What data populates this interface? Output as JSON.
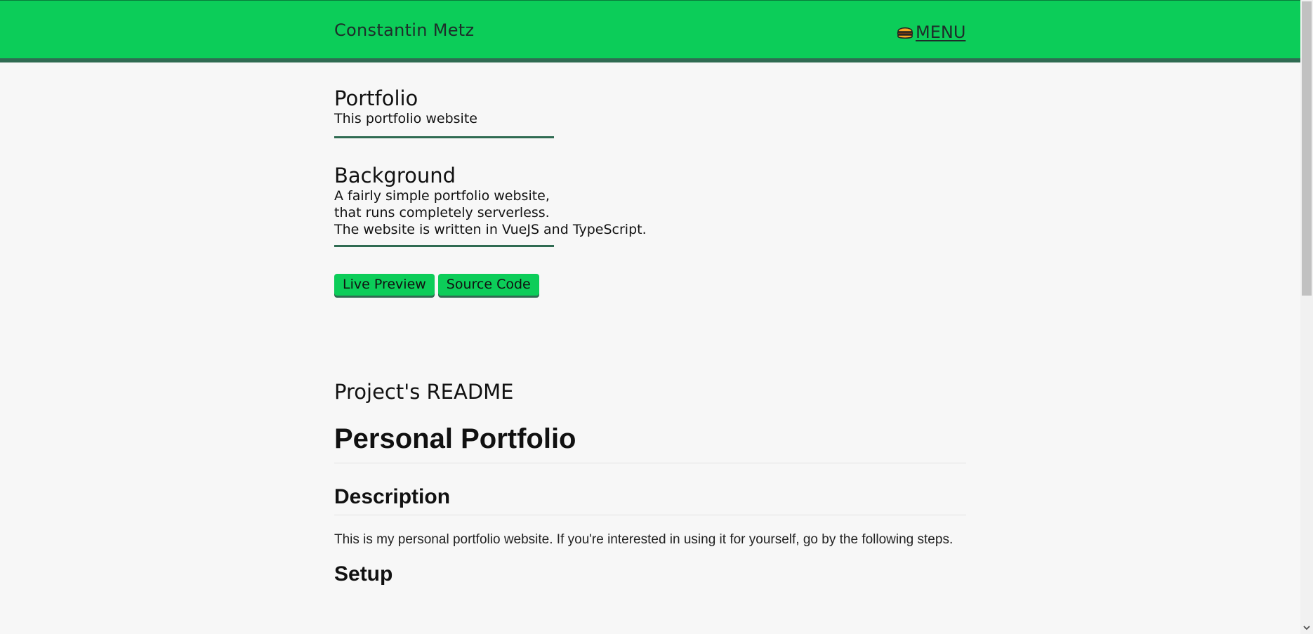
{
  "header": {
    "site_title": "Constantin Metz",
    "menu_label": "MENU",
    "menu_icon": "burger-icon"
  },
  "project": {
    "title": "Portfolio",
    "subtitle": "This portfolio website",
    "background_heading": "Background",
    "background_lines": [
      "A fairly simple portfolio website,",
      "that runs completely serverless.",
      "The website is written in VueJS and TypeScript."
    ],
    "buttons": {
      "live_preview": "Live Preview",
      "source_code": "Source Code"
    }
  },
  "readme": {
    "section_title": "Project's README",
    "h1": "Personal Portfolio",
    "description_heading": "Description",
    "description_text": "This is my personal portfolio website. If you're interested in using it for yourself, go by the following steps.",
    "setup_heading": "Setup"
  },
  "colors": {
    "accent": "#0ccd59",
    "accent_dark": "#2f6b52",
    "background": "#f7f7f7"
  }
}
